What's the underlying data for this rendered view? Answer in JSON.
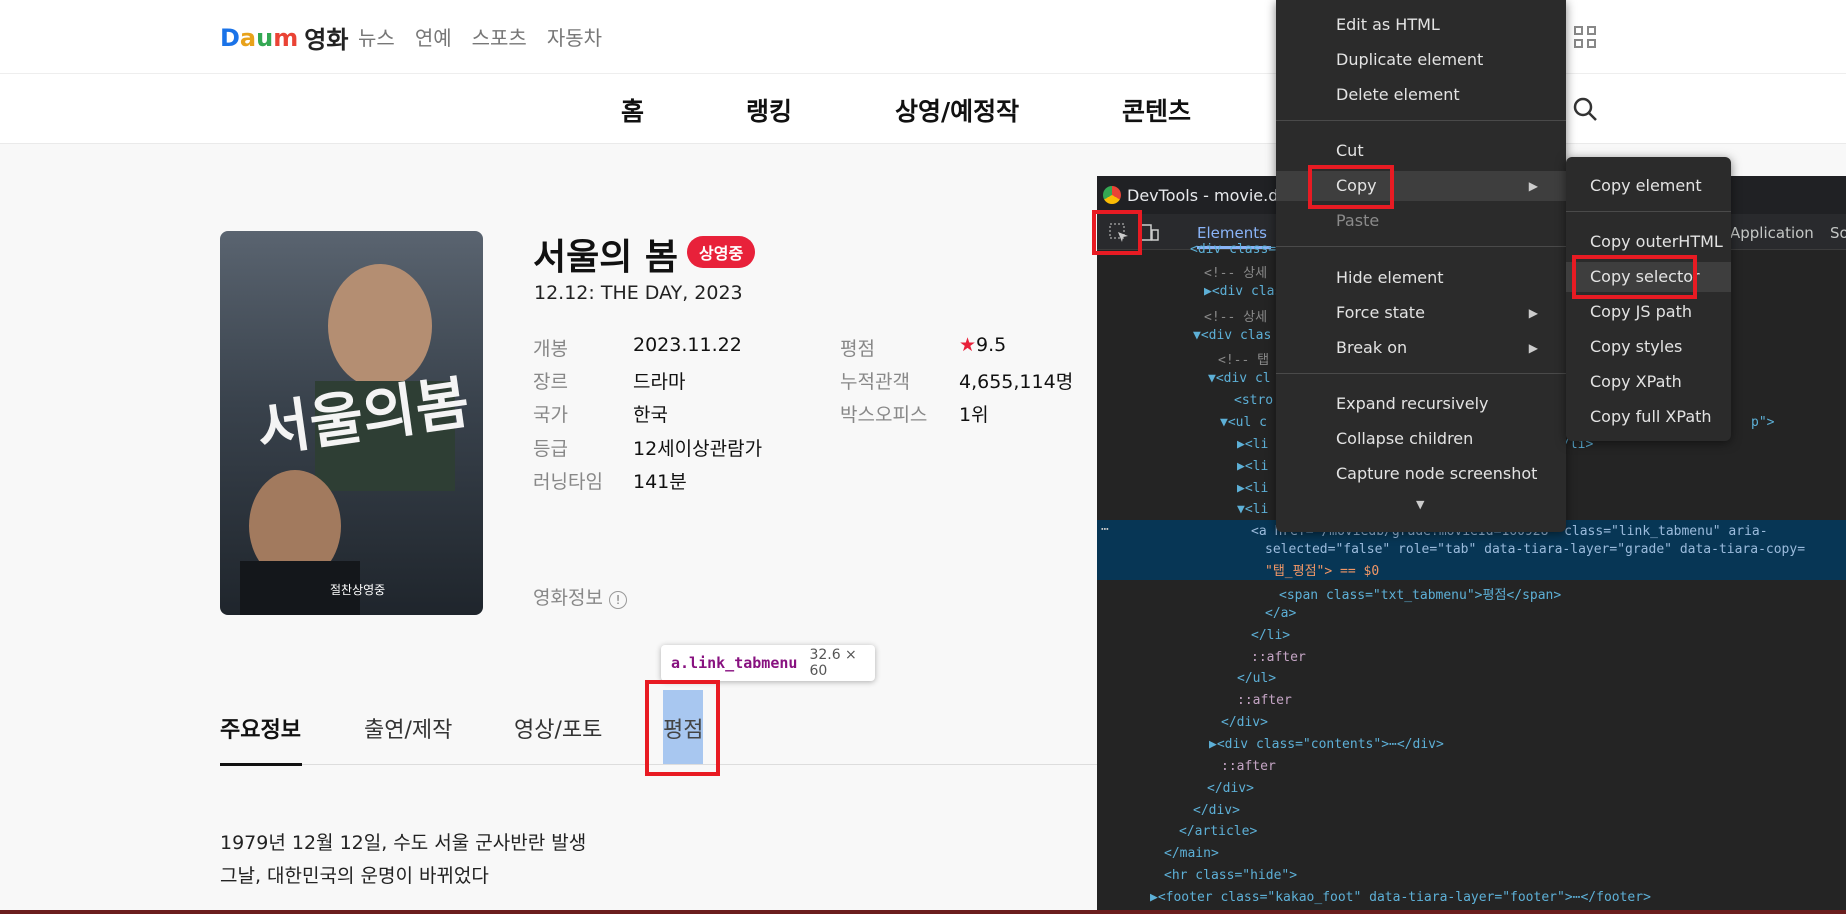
{
  "header": {
    "logo_text": "영화",
    "top_links": [
      "뉴스",
      "연예",
      "스포츠",
      "자동차"
    ],
    "main_nav": [
      "홈",
      "랭킹",
      "상영/예정작",
      "콘텐츠"
    ]
  },
  "movie": {
    "title": "서울의 봄",
    "badge": "상영중",
    "subtitle": "12.12: THE DAY, 2023",
    "info_left": [
      {
        "label": "개봉",
        "value": "2023.11.22"
      },
      {
        "label": "장르",
        "value": "드라마"
      },
      {
        "label": "국가",
        "value": "한국"
      },
      {
        "label": "등급",
        "value": "12세이상관람가"
      },
      {
        "label": "러닝타임",
        "value": "141분"
      }
    ],
    "info_right": [
      {
        "label": "평점",
        "value": "9.5"
      },
      {
        "label": "누적관객",
        "value": "4,655,114명"
      },
      {
        "label": "박스오피스",
        "value": "1위"
      }
    ],
    "movie_info_label": "영화정보",
    "tabs": [
      "주요정보",
      "출연/제작",
      "영상/포토",
      "평점"
    ],
    "synopsis": [
      "1979년 12월 12일, 수도 서울 군사반란 발생",
      "그날, 대한민국의 운명이 바뀌었다"
    ]
  },
  "inspector_tooltip": {
    "selector": "a.link_tabmenu",
    "size": "32.6 × 60"
  },
  "devtools": {
    "title": "DevTools - movie.dau",
    "tabs": [
      "Elements",
      "Application",
      "So"
    ],
    "code_lines": [
      "<div class=",
      "<!-- 상세",
      "<div clas",
      "<!-- 상세",
      "<div clas",
      "<!-- 탭",
      "<div cl",
      "<stro",
      "<ul c",
      "<li",
      "<li",
      "<li",
      "<li"
    ],
    "code_tail_ul": "p\">",
    "code_tail_li": "/li>",
    "selected_line_1": "<a href=\"/moviedb/grade?movieId=160928\" class=\"link_tabmenu\" aria-",
    "selected_line_2": "selected=\"false\" role=\"tab\" data-tiara-layer=\"grade\" data-tiara-copy=",
    "selected_line_3": "\"탭_평점\"> == $0",
    "span_line": "<span class=\"txt_tabmenu\">평점</span>",
    "close_a": "</a>",
    "close_li": "</li>",
    "after1": "::after",
    "close_ul": "</ul>",
    "after2": "::after",
    "close_div1": "</div>",
    "contents_line": "<div class=\"contents\">⋯</div>",
    "after3": "::after",
    "close_div2": "</div>",
    "close_div3": "</div>",
    "close_article": "</article>",
    "close_main": "</main>",
    "hr_line": "<hr class=\"hide\">",
    "footer_line": "<footer class=\"kakao_foot\" data-tiara-layer=\"footer\">⋯</footer>"
  },
  "context_menu": {
    "items": [
      "Edit as HTML",
      "Duplicate element",
      "Delete element",
      "Cut",
      "Copy",
      "Paste",
      "Hide element",
      "Force state",
      "Break on",
      "Expand recursively",
      "Collapse children",
      "Capture node screenshot"
    ]
  },
  "copy_submenu": {
    "items": [
      "Copy element",
      "Copy outerHTML",
      "Copy selector",
      "Copy JS path",
      "Copy styles",
      "Copy XPath",
      "Copy full XPath"
    ]
  },
  "colors": {
    "highlight_red": "#e81b23",
    "badge_red": "#e8213a",
    "devtools_bg": "#242424"
  }
}
